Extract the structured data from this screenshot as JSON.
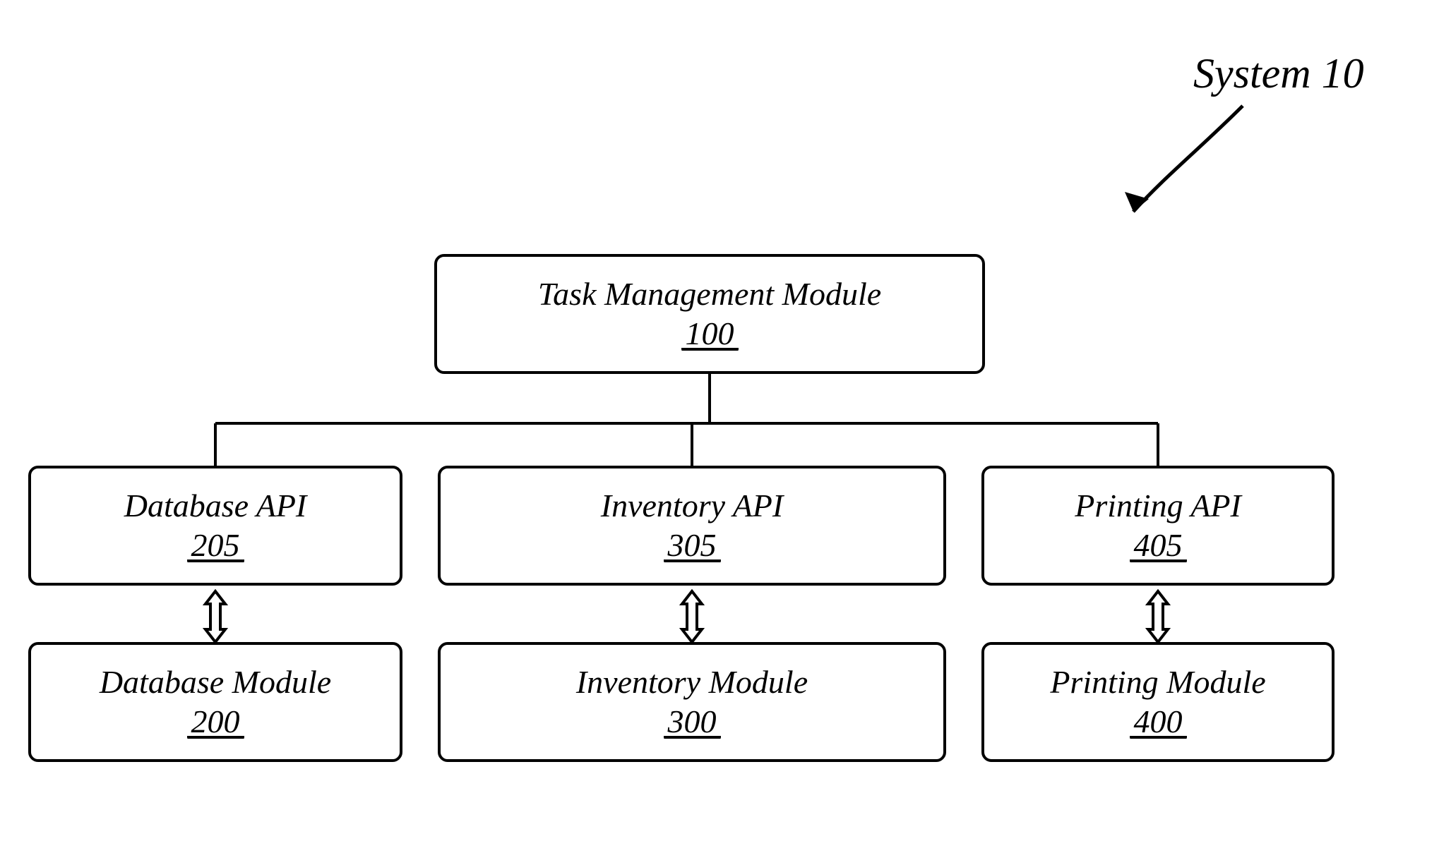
{
  "system_label": "System  10",
  "boxes": {
    "task_mgmt": {
      "title": "Task Management Module",
      "num": "100"
    },
    "db_api": {
      "title": "Database API",
      "num": "205"
    },
    "inv_api": {
      "title": "Inventory API",
      "num": "305"
    },
    "prn_api": {
      "title": "Printing API",
      "num": "405"
    },
    "db_mod": {
      "title": "Database Module",
      "num": "200"
    },
    "inv_mod": {
      "title": "Inventory Module",
      "num": "300"
    },
    "prn_mod": {
      "title": "Printing Module",
      "num": "400"
    }
  }
}
